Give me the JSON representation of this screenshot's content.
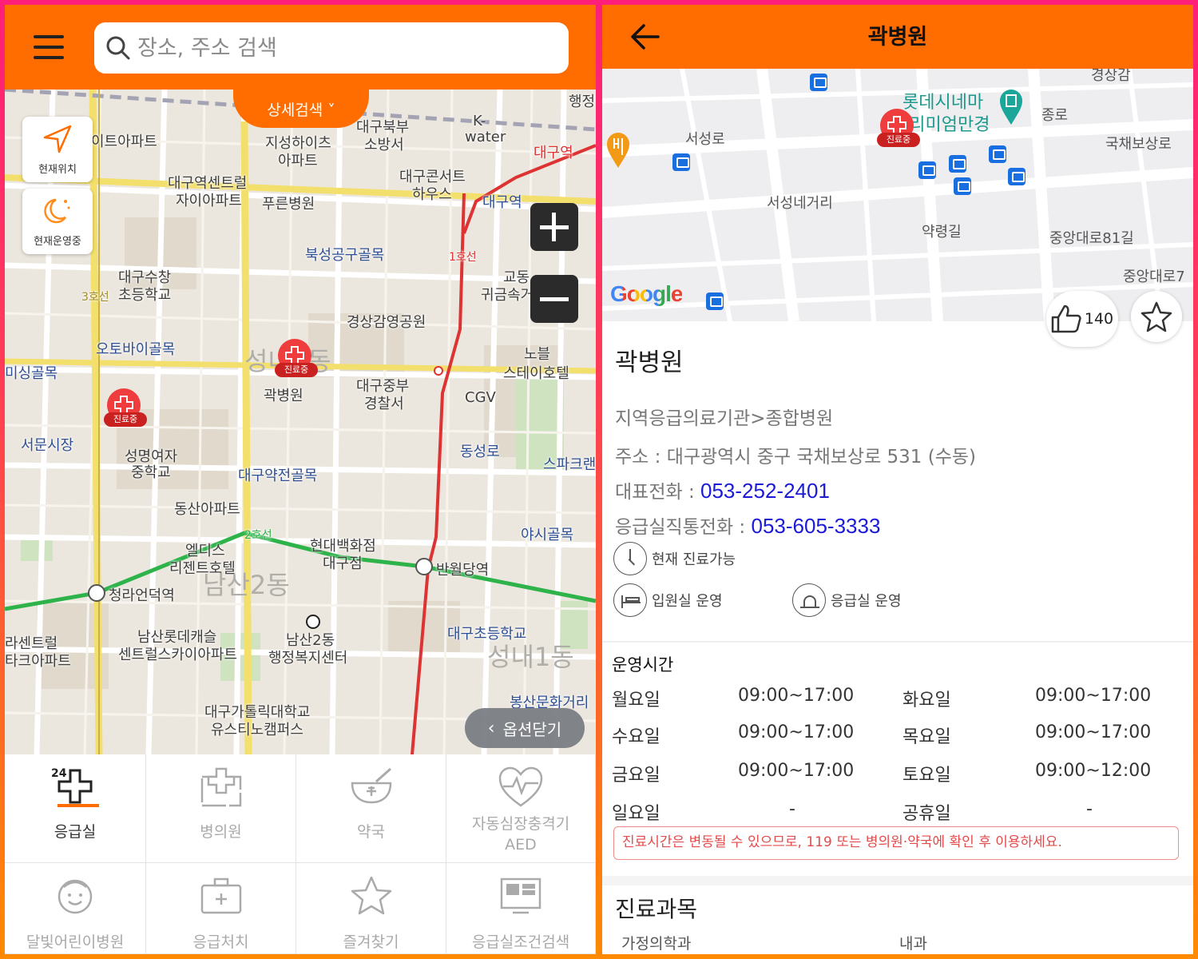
{
  "left": {
    "search": {
      "placeholder": "장소, 주소 검색"
    },
    "detail_search_label": "상세검색 ˅",
    "current_location_label": "현재위치",
    "open_now_label": "현재운영중",
    "close_options_label": "옵션닫기",
    "map_labels": [
      "대구역센트럴",
      "자이아파트",
      "지성하이츠",
      "아파트",
      "푸른병원",
      "대구북부",
      "소방서",
      "K-",
      "water",
      "대구콘서트",
      "하우스",
      "대구역",
      "대구역",
      "행정",
      "북성공구골목",
      "대구수창",
      "초등학교",
      "오토바이골목",
      "경상감영공원",
      "교동",
      "귀금속거리",
      "노블",
      "스테이호텔",
      "미싱골목",
      "곽병원",
      "대구중부",
      "경찰서",
      "CGV",
      "서문시장",
      "성명여자",
      "중학교",
      "동성로",
      "스파크랜",
      "대구약전골목",
      "동산아파트",
      "야시골목",
      "엘디스",
      "리젠트호텔",
      "현대백화점",
      "대구점",
      "반월당역",
      "청라언덕역",
      "남산롯데캐슬",
      "센트럴스카이아파트",
      "남산2동",
      "행정복지센터",
      "대구초등학교",
      "대구가톨릭대학교",
      "유스티노캠퍼스",
      "봉산문화거리",
      "이트아파트",
      "라센트럴",
      "타크아파트",
      "1호선",
      "2호선",
      "3호선",
      "성내2동",
      "남산2동",
      "성내1동"
    ],
    "markers": [
      "진료중",
      "진료중"
    ],
    "categories": [
      {
        "label": "응급실",
        "active": true
      },
      {
        "label": "병의원"
      },
      {
        "label": "약국"
      },
      {
        "label": "자동심장충격기\nAED"
      },
      {
        "label": "달빛어린이병원"
      },
      {
        "label": "응급처치"
      },
      {
        "label": "즐겨찾기"
      },
      {
        "label": "응급실조건검색"
      }
    ]
  },
  "right": {
    "title": "곽병원",
    "map_labels": [
      "롯데시네마",
      "프리미엄만경",
      "서성로",
      "서성네거리",
      "약령길",
      "국채보상로",
      "중앙대로81길",
      "중앙대로7",
      "종로",
      "경상감"
    ],
    "map_marker": "진료중",
    "google_logo": "Google",
    "likes": "140",
    "name": "곽병원",
    "category": "지역응급의료기관>종합병원",
    "address": "주소 : 대구광역시 중구 국채보상로 531 (수동)",
    "phone_label": "대표전화 : ",
    "phone": "053-252-2401",
    "er_phone_label": "응급실직통전화 : ",
    "er_phone": "053-605-3333",
    "feature_available": "현재 진료가능",
    "feature_ward": "입원실 운영",
    "feature_er": "응급실 운영",
    "hours_title": "운영시간",
    "hours": [
      {
        "d1": "월요일",
        "t1": "09:00~17:00",
        "d2": "화요일",
        "t2": "09:00~17:00"
      },
      {
        "d1": "수요일",
        "t1": "09:00~17:00",
        "d2": "목요일",
        "t2": "09:00~17:00"
      },
      {
        "d1": "금요일",
        "t1": "09:00~17:00",
        "d2": "토요일",
        "t2": "09:00~12:00"
      },
      {
        "d1": "일요일",
        "t1": "-",
        "d2": "공휴일",
        "t2": "-"
      }
    ],
    "notice": "진료시간은 변동될 수 있으므로, 119 또는 병의원·약국에 확인 후 이용하세요.",
    "dept_title": "진료과목",
    "departments": [
      "가정의학과",
      "내과"
    ]
  }
}
